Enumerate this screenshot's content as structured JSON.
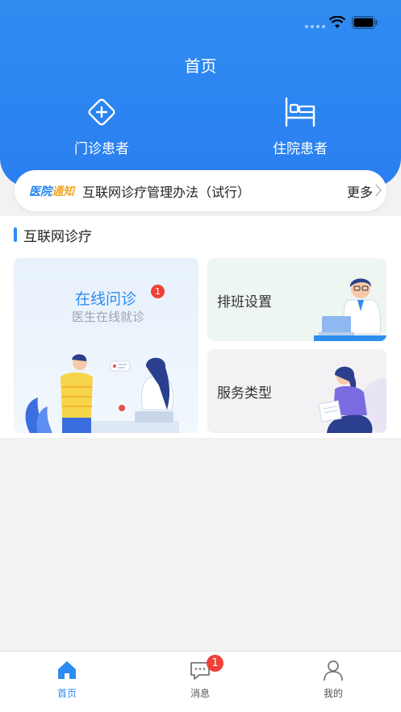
{
  "header": {
    "title": "首页",
    "quick_entries": [
      {
        "label": "门诊患者",
        "icon": "plus-diamond-icon"
      },
      {
        "label": "住院患者",
        "icon": "hospital-bed-icon"
      }
    ]
  },
  "notice": {
    "tag_part1": "医院",
    "tag_part2": "通知",
    "text": "互联网诊疗管理办法（试行）",
    "more_label": "更多"
  },
  "section": {
    "title": "互联网诊疗",
    "cards": {
      "online": {
        "title": "在线问诊",
        "subtitle": "医生在线就诊",
        "badge": "1"
      },
      "schedule": {
        "label": "排班设置"
      },
      "service": {
        "label": "服务类型"
      }
    }
  },
  "tabbar": {
    "tabs": [
      {
        "label": "首页",
        "icon": "home-icon",
        "active": true
      },
      {
        "label": "消息",
        "icon": "message-icon",
        "badge": "1"
      },
      {
        "label": "我的",
        "icon": "user-icon"
      }
    ]
  },
  "colors": {
    "primary": "#2e8cf0",
    "badge": "#f04136",
    "notice_tag_highlight": "#f5a623"
  }
}
